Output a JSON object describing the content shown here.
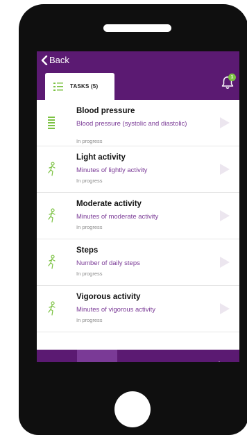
{
  "header": {
    "back_label": "Back"
  },
  "tabs": {
    "active_label": "TASKS (5)"
  },
  "notifications": {
    "badge_count": "1"
  },
  "tasks": [
    {
      "title": "Blood pressure",
      "description": "Blood pressure (systolic and diastolic)",
      "status": "In progress",
      "icon": "list-icon"
    },
    {
      "title": "Light activity",
      "description": "Minutes of lightly activity",
      "status": "In progress",
      "icon": "running-person-icon"
    },
    {
      "title": "Moderate activity",
      "description": "Minutes of moderate activity",
      "status": "In progress",
      "icon": "running-person-icon"
    },
    {
      "title": "Steps",
      "description": "Number of daily steps",
      "status": "In progress",
      "icon": "running-person-icon"
    },
    {
      "title": "Vigorous activity",
      "description": "Minutes of vigorous activity",
      "status": "In progress",
      "icon": "running-person-icon"
    }
  ],
  "nav": [
    "home-icon",
    "tasks-list-icon",
    "profile-icon",
    "chat-icon",
    "settings-gear-icon"
  ],
  "colors": {
    "primary": "#5b1a72",
    "active_nav": "#7a3a96",
    "accent_green": "#7cc243",
    "desc_text": "#7a3a96"
  }
}
